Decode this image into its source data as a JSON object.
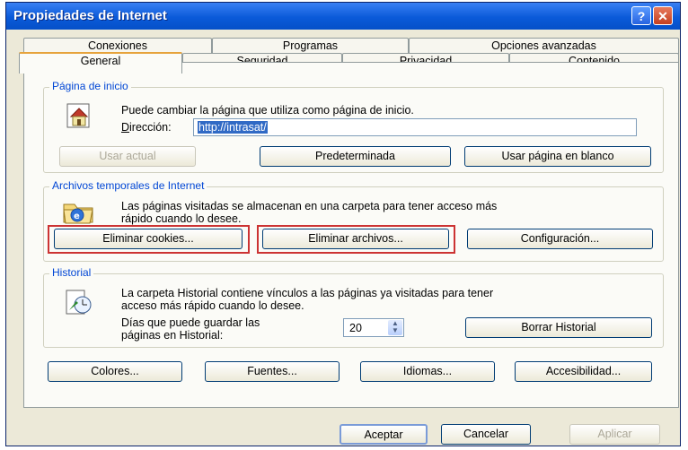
{
  "window": {
    "title": "Propiedades de Internet",
    "help": "?",
    "close": "✕"
  },
  "tabs_row1": [
    "Conexiones",
    "Programas",
    "Opciones avanzadas"
  ],
  "tabs_row2": [
    "General",
    "Seguridad",
    "Privacidad",
    "Contenido"
  ],
  "home": {
    "label": "Página de inicio",
    "desc": "Puede cambiar la página que utiliza como página de inicio.",
    "address_label": "Dirección:",
    "address_value": "http://intrasat/",
    "btn_current": "Usar actual",
    "btn_default": "Predeterminada",
    "btn_blank": "Usar página en blanco"
  },
  "temp": {
    "label": "Archivos temporales de Internet",
    "desc1": "Las páginas visitadas se almacenan en una carpeta para tener acceso más",
    "desc2": "rápido cuando lo desee.",
    "btn_cookies": "Eliminar cookies...",
    "btn_files": "Eliminar archivos...",
    "btn_config": "Configuración..."
  },
  "history": {
    "label": "Historial",
    "desc1": "La carpeta Historial contiene vínculos a las páginas ya visitadas para tener",
    "desc2": "acceso más rápido cuando lo desee.",
    "days1": "Días que puede guardar las",
    "days2": "páginas en Historial:",
    "days_value": "20",
    "btn_clear": "Borrar Historial"
  },
  "bottom": {
    "colors": "Colores...",
    "fonts": "Fuentes...",
    "languages": "Idiomas...",
    "access": "Accesibilidad..."
  },
  "footer": {
    "ok": "Aceptar",
    "cancel": "Cancelar",
    "apply": "Aplicar"
  }
}
